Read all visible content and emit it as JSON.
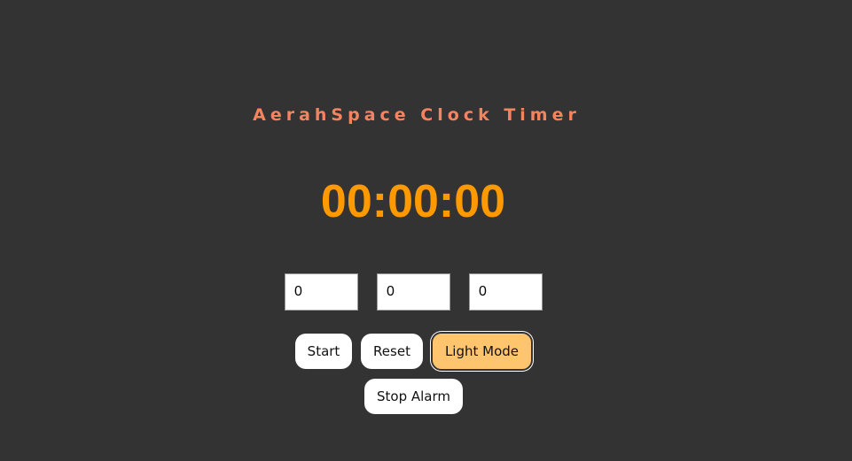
{
  "app": {
    "title": "AerahSpace Clock Timer"
  },
  "timer": {
    "display": "00:00:00"
  },
  "inputs": {
    "hours": "0",
    "minutes": "0",
    "seconds": "0"
  },
  "buttons": {
    "start": "Start",
    "reset": "Reset",
    "light_mode": "Light Mode",
    "stop_alarm": "Stop Alarm"
  },
  "colors": {
    "background": "#333333",
    "title": "#f4845f",
    "display": "#ff9900",
    "accent_button": "#ffc56e"
  }
}
